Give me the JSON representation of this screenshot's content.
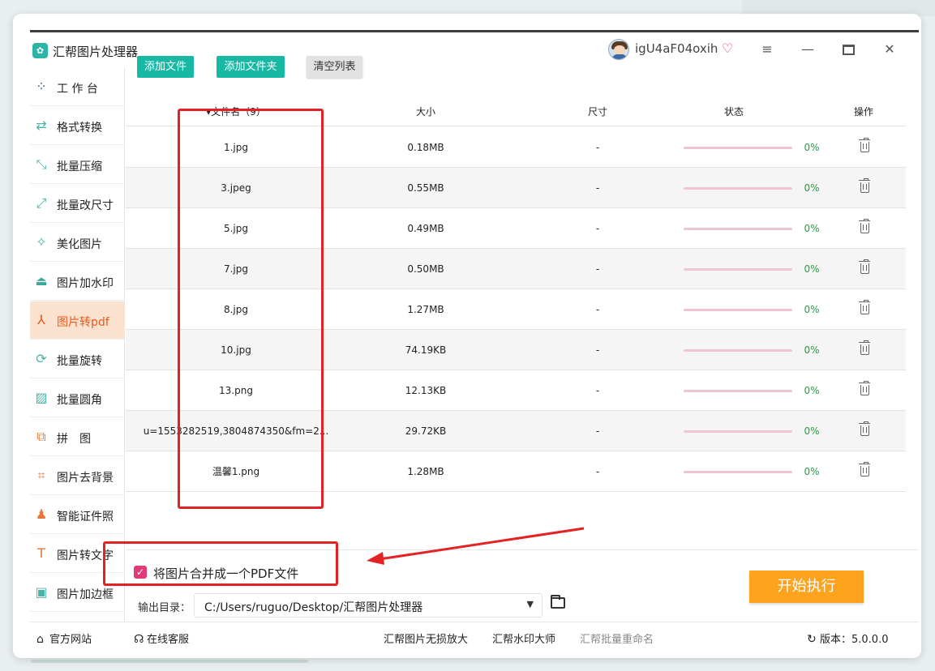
{
  "app": {
    "title": "汇帮图片处理器",
    "username": "igU4aF04oxih"
  },
  "sidebar": {
    "items": [
      {
        "label": "工 作 台",
        "icon": "grid-icon"
      },
      {
        "label": "格式转换",
        "icon": "format-convert-icon"
      },
      {
        "label": "批量压缩",
        "icon": "compress-icon"
      },
      {
        "label": "批量改尺寸",
        "icon": "resize-icon"
      },
      {
        "label": "美化图片",
        "icon": "beautify-icon"
      },
      {
        "label": "图片加水印",
        "icon": "watermark-icon"
      },
      {
        "label": "图片转pdf",
        "icon": "pdf-icon",
        "active": true
      },
      {
        "label": "批量旋转",
        "icon": "rotate-icon"
      },
      {
        "label": "批量圆角",
        "icon": "rounded-corner-icon"
      },
      {
        "label": "拼　图",
        "icon": "puzzle-icon"
      },
      {
        "label": "图片去背景",
        "icon": "crop-icon"
      },
      {
        "label": "智能证件照",
        "icon": "id-photo-icon"
      },
      {
        "label": "图片转文字",
        "icon": "text-icon"
      },
      {
        "label": "图片加边框",
        "icon": "border-icon"
      }
    ]
  },
  "toolbar": {
    "add_file": "添加文件",
    "add_folder": "添加文件夹",
    "clear_list": "清空列表"
  },
  "table": {
    "headers": {
      "name": "▾文件名（9）",
      "size": "大小",
      "dimension": "尺寸",
      "status": "状态",
      "action": "操作"
    },
    "rows": [
      {
        "name": "1.jpg",
        "size": "0.18MB",
        "dimension": "-",
        "progress": 0,
        "percent": "0%"
      },
      {
        "name": "3.jpeg",
        "size": "0.55MB",
        "dimension": "-",
        "progress": 0,
        "percent": "0%"
      },
      {
        "name": "5.jpg",
        "size": "0.49MB",
        "dimension": "-",
        "progress": 0,
        "percent": "0%"
      },
      {
        "name": "7.jpg",
        "size": "0.50MB",
        "dimension": "-",
        "progress": 0,
        "percent": "0%"
      },
      {
        "name": "8.jpg",
        "size": "1.27MB",
        "dimension": "-",
        "progress": 0,
        "percent": "0%"
      },
      {
        "name": "10.jpg",
        "size": "74.19KB",
        "dimension": "-",
        "progress": 0,
        "percent": "0%"
      },
      {
        "name": "13.png",
        "size": "12.13KB",
        "dimension": "-",
        "progress": 0,
        "percent": "0%"
      },
      {
        "name": "u=1553282519,3804874350&fm=2...",
        "size": "29.72KB",
        "dimension": "-",
        "progress": 0,
        "percent": "0%"
      },
      {
        "name": "温馨1.png",
        "size": "1.28MB",
        "dimension": "-",
        "progress": 0,
        "percent": "0%"
      }
    ]
  },
  "options": {
    "merge_label": "将图片合并成一个PDF文件",
    "merge_checked": true
  },
  "output": {
    "label": "输出目录：",
    "path": "C:/Users/ruguo/Desktop/汇帮图片处理器"
  },
  "actions": {
    "start": "开始执行"
  },
  "footer": {
    "home": "官方网站",
    "service": "在线客服",
    "product1": "汇帮图片无损放大",
    "product2": "汇帮水印大师",
    "product3": "汇帮批量重命名",
    "version": "版本：5.0.0.0"
  },
  "colors": {
    "accent_teal": "#18b9a4",
    "start_orange": "#fea31d",
    "active_bg": "#fbe2cf",
    "annotation_red": "#e32323"
  }
}
